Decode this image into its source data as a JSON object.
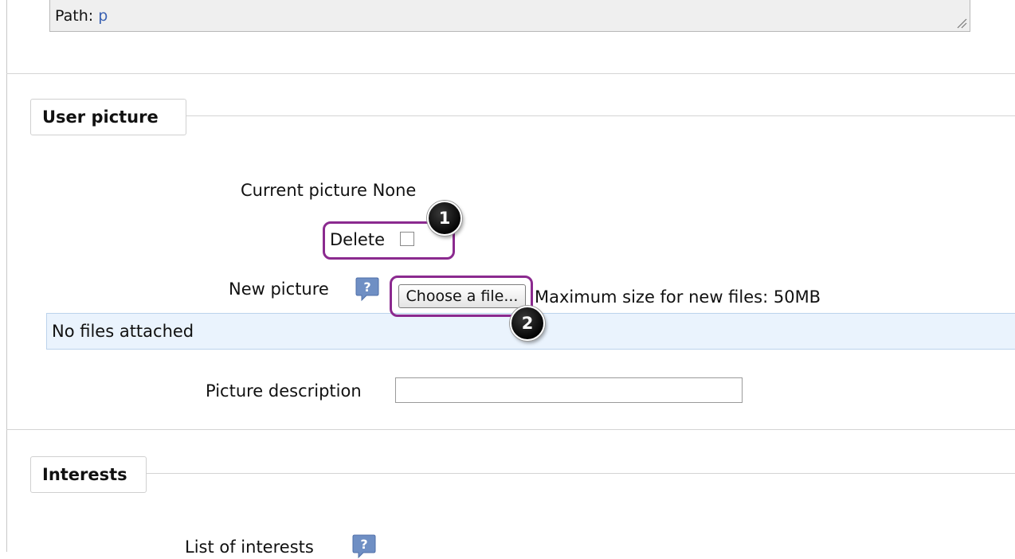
{
  "path_field": {
    "label": "Path:",
    "value": "p"
  },
  "user_picture": {
    "legend": "User picture",
    "current_picture": "Current picture None",
    "delete_label": "Delete",
    "new_picture_label": "New picture",
    "choose_file_button": "Choose a file...",
    "max_size_text": "Maximum size for new files: 50MB",
    "no_files_text": "No files attached",
    "picture_description_label": "Picture description",
    "picture_description_value": ""
  },
  "interests": {
    "legend": "Interests",
    "list_label": "List of interests"
  },
  "annotations": {
    "marker_1": "1",
    "marker_2": "2",
    "callout_color": "#8b2a8f"
  },
  "colors": {
    "link_blue": "#3a62b3",
    "help_icon": "#6f8fc4",
    "no_files_bg": "#eaf3fd"
  },
  "icons": {
    "help": "help-question-icon",
    "resize": "resize-grip-icon"
  }
}
